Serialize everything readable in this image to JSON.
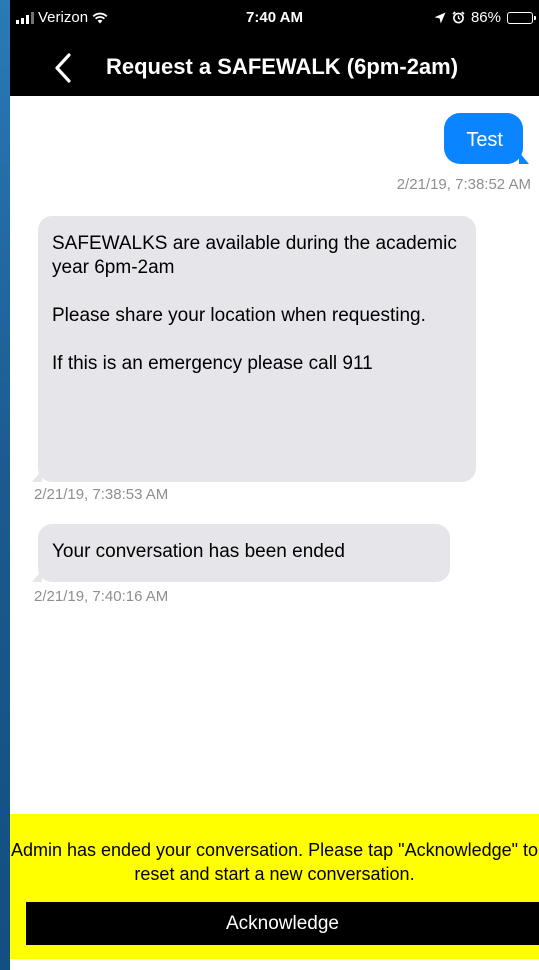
{
  "status_bar": {
    "carrier": "Verizon",
    "time": "7:40 AM",
    "battery": "86%",
    "battery_level": 0.86,
    "icons": [
      "signal-icon",
      "wifi-icon",
      "location-arrow-icon",
      "alarm-icon",
      "battery-icon"
    ]
  },
  "nav": {
    "title": "Request a SAFEWALK (6pm-2am)",
    "back_icon": "chevron-left-icon"
  },
  "messages": {
    "outgoing": [
      {
        "text": "Test",
        "timestamp": "2/21/19, 7:38:52 AM"
      }
    ],
    "incoming": [
      {
        "lines": [
          "SAFEWALKS are available during the academic year 6pm-2am",
          "Please share your location when requesting.",
          "If this is an emergency please call 911"
        ],
        "timestamp": "2/21/19, 7:38:53 AM"
      },
      {
        "text": "Your conversation has been ended",
        "timestamp": "2/21/19, 7:40:16 AM"
      }
    ]
  },
  "banner": {
    "message": "Admin has ended your conversation. Please tap \"Acknowledge\" to reset and start a new conversation.",
    "button_label": "Acknowledge"
  },
  "colors": {
    "bubble_out": "#0b84ff",
    "bubble_in": "#e5e5ea",
    "banner_bg": "#ffff00",
    "timestamp": "#8e8e93"
  }
}
